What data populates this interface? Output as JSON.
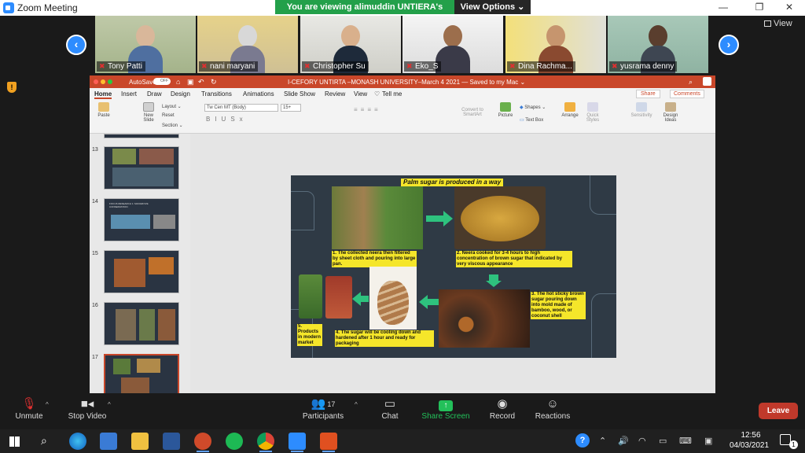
{
  "window": {
    "app_title": "Zoom Meeting",
    "minimize": "—",
    "maximize": "❐",
    "close": "✕"
  },
  "banner": {
    "viewing_text": "You are viewing alimuddin UNTIERA's screen",
    "view_options": "View Options ⌄"
  },
  "view_button": "View",
  "participants_strip": [
    {
      "name": "Tony Patti",
      "muted": true
    },
    {
      "name": "nani maryani",
      "muted": true
    },
    {
      "name": "Christopher Su",
      "muted": true
    },
    {
      "name": "Eko_S",
      "muted": true
    },
    {
      "name": "Dina Rachma...",
      "muted": true
    },
    {
      "name": "yusrama denny",
      "muted": true
    }
  ],
  "ppt": {
    "title": "I-CEFORY UNTIRTA –MONASH UNIVERSITY–March 4 2021 — Saved to my Mac ⌄",
    "autosave": "AutoSave",
    "autosave_state": "OFF",
    "tabs": [
      "Home",
      "Insert",
      "Draw",
      "Design",
      "Transitions",
      "Animations",
      "Slide Show",
      "Review",
      "View"
    ],
    "tell_me": "Tell me",
    "share": "Share",
    "comments": "Comments",
    "ribbon": {
      "paste": "Paste",
      "new_slide": "New\nSlide",
      "layout": "Layout ⌄",
      "reset": "Reset",
      "section": "Section ⌄",
      "font_name": "Tw Cen MT (Body)",
      "font_size": "15+",
      "convert": "Convert to\nSmartArt",
      "picture": "Picture",
      "shapes": "Shapes ⌄",
      "text_box": "Text Box",
      "arrange": "Arrange",
      "quick_styles": "Quick\nStyles",
      "sensitivity": "Sensitivity",
      "design_ideas": "Design\nIdeas"
    },
    "slide_numbers": [
      "13",
      "14",
      "15",
      "16",
      "17"
    ],
    "selected_slide": "17",
    "slide14_caption": "FOCUS RESEARCH 1: MANGROVE CONSERVATION",
    "slide": {
      "title": "Palm sugar is produced in a way",
      "step1": "1. The collected neera then filtered by sheet cloth and pouring into large pan.",
      "step2": "2. Neera cooked for 3-4 hours to high concentration of brown sugar that indicated by very viscous appearance",
      "step3": "3. The hot sticky brown sugar pouring down into mold made of bamboo, wood, or coconut shell",
      "step4": "4. The sugar will be cooling down and hardened after 1 hour and ready for packaging",
      "step5": "5. Products in modern market"
    }
  },
  "toolbar": {
    "unmute": "Unmute",
    "stop_video": "Stop Video",
    "participants": "Participants",
    "participants_count": "17",
    "chat": "Chat",
    "share_screen": "Share Screen",
    "record": "Record",
    "reactions": "Reactions",
    "leave": "Leave"
  },
  "taskbar": {
    "time": "12:56",
    "date": "04/03/2021",
    "notif_count": "1"
  },
  "colors": {
    "zoom_blue": "#2d8cff",
    "share_green": "#23a04a",
    "ppt_red": "#c9472a",
    "leave_red": "#c0392b",
    "slide_yellow": "#f5e62a"
  }
}
